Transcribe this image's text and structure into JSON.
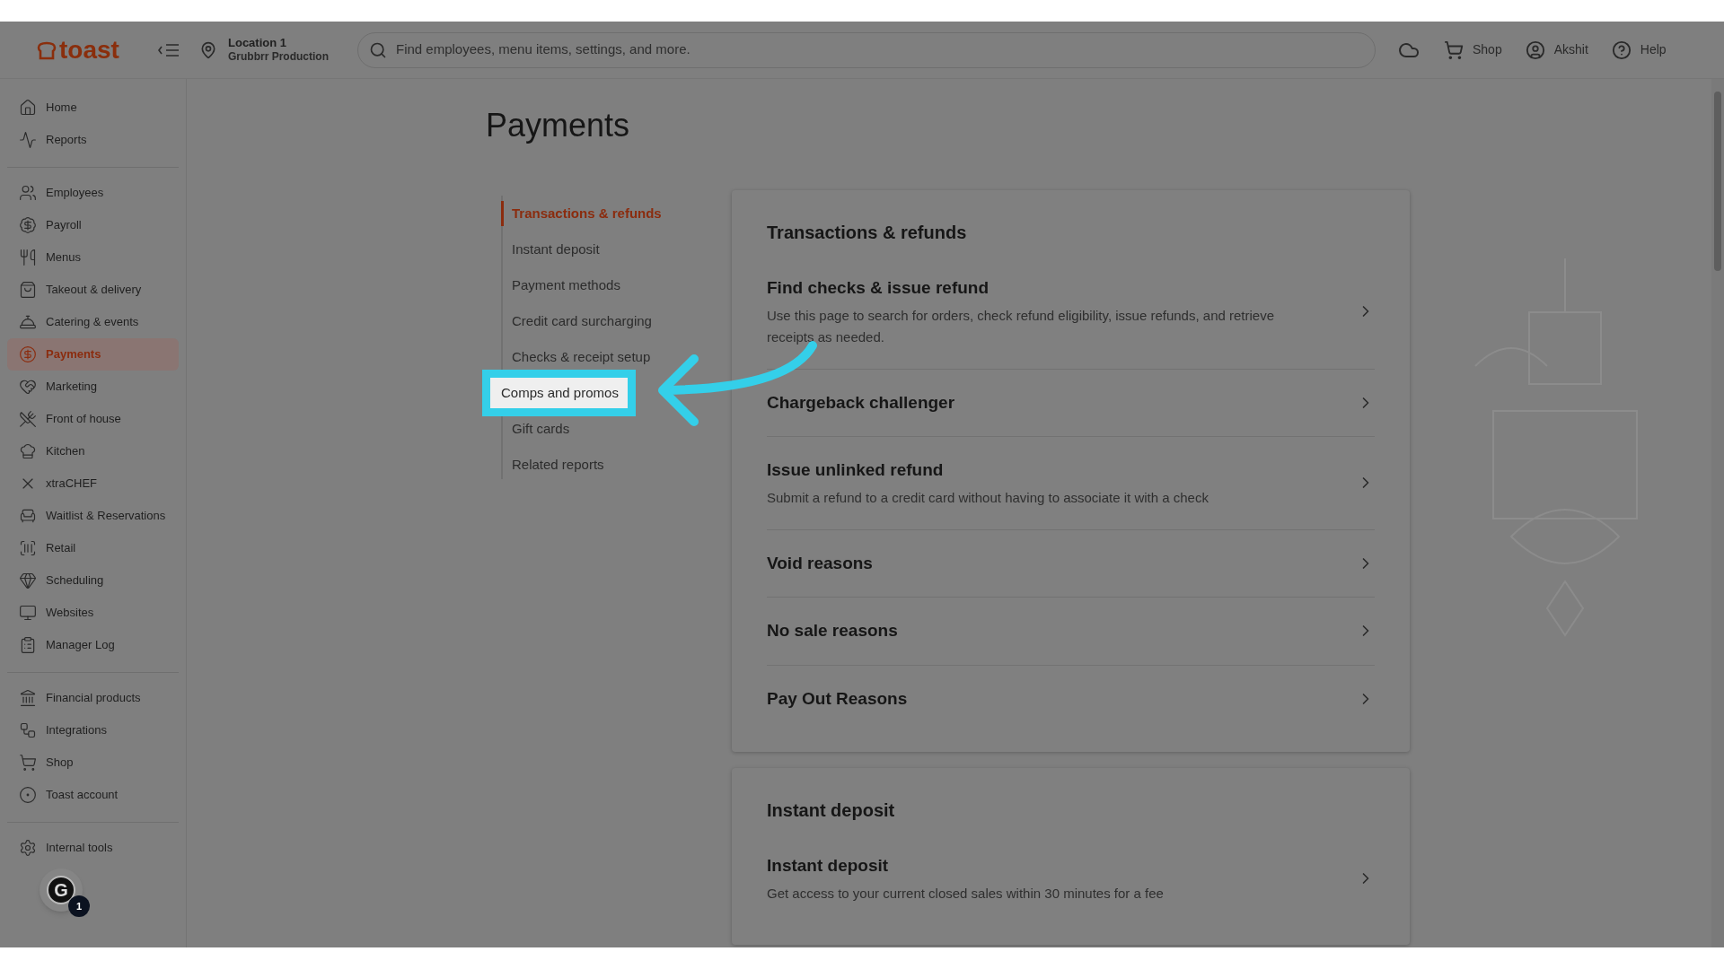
{
  "header": {
    "logo": "toast",
    "location": {
      "title": "Location 1",
      "subtitle": "Grubbrr Production"
    },
    "search": {
      "placeholder": "Find employees, menu items, settings, and more."
    },
    "actions": [
      {
        "label": "Shop"
      },
      {
        "label": "Akshit"
      },
      {
        "label": "Help"
      }
    ]
  },
  "sidebar": {
    "groups": [
      [
        {
          "label": "Home",
          "selected": false
        },
        {
          "label": "Reports",
          "selected": false
        }
      ],
      [
        {
          "label": "Employees",
          "selected": false
        },
        {
          "label": "Payroll",
          "selected": false
        },
        {
          "label": "Menus",
          "selected": false
        },
        {
          "label": "Takeout & delivery",
          "selected": false
        },
        {
          "label": "Catering & events",
          "selected": false
        },
        {
          "label": "Payments",
          "selected": true
        },
        {
          "label": "Marketing",
          "selected": false
        },
        {
          "label": "Front of house",
          "selected": false
        },
        {
          "label": "Kitchen",
          "selected": false
        },
        {
          "label": "xtraCHEF",
          "selected": false
        },
        {
          "label": "Waitlist & Reservations",
          "selected": false
        },
        {
          "label": "Retail",
          "selected": false
        },
        {
          "label": "Scheduling",
          "selected": false
        },
        {
          "label": "Websites",
          "selected": false
        },
        {
          "label": "Manager Log",
          "selected": false
        }
      ],
      [
        {
          "label": "Financial products",
          "selected": false
        },
        {
          "label": "Integrations",
          "selected": false
        },
        {
          "label": "Shop",
          "selected": false
        },
        {
          "label": "Toast account",
          "selected": false
        }
      ],
      [
        {
          "label": "Internal tools",
          "selected": false
        }
      ]
    ],
    "assistant": {
      "letter": "G",
      "badge": "1"
    }
  },
  "page": {
    "title": "Payments"
  },
  "subnav": [
    {
      "label": "Transactions & refunds",
      "selected": true,
      "highlighted": false
    },
    {
      "label": "Instant deposit",
      "selected": false,
      "highlighted": false
    },
    {
      "label": "Payment methods",
      "selected": false,
      "highlighted": false
    },
    {
      "label": "Credit card surcharging",
      "selected": false,
      "highlighted": false
    },
    {
      "label": "Checks & receipt setup",
      "selected": false,
      "highlighted": false
    },
    {
      "label": "Comps and promos",
      "selected": false,
      "highlighted": true
    },
    {
      "label": "Gift cards",
      "selected": false,
      "highlighted": false
    },
    {
      "label": "Related reports",
      "selected": false,
      "highlighted": false
    }
  ],
  "cards": [
    {
      "title": "Transactions & refunds",
      "rows": [
        {
          "title": "Find checks & issue refund",
          "description": "Use this page to search for orders, check refund eligibility, issue refunds, and retrieve receipts as needed."
        },
        {
          "title": "Chargeback challenger"
        },
        {
          "title": "Issue unlinked refund",
          "description": "Submit a refund to a credit card without having to associate it with a check"
        },
        {
          "title": "Void reasons"
        },
        {
          "title": "No sale reasons"
        },
        {
          "title": "Pay Out Reasons"
        }
      ]
    },
    {
      "title": "Instant deposit",
      "rows": [
        {
          "title": "Instant deposit",
          "description": "Get access to your current closed sales within 30 minutes for a fee"
        }
      ]
    }
  ]
}
